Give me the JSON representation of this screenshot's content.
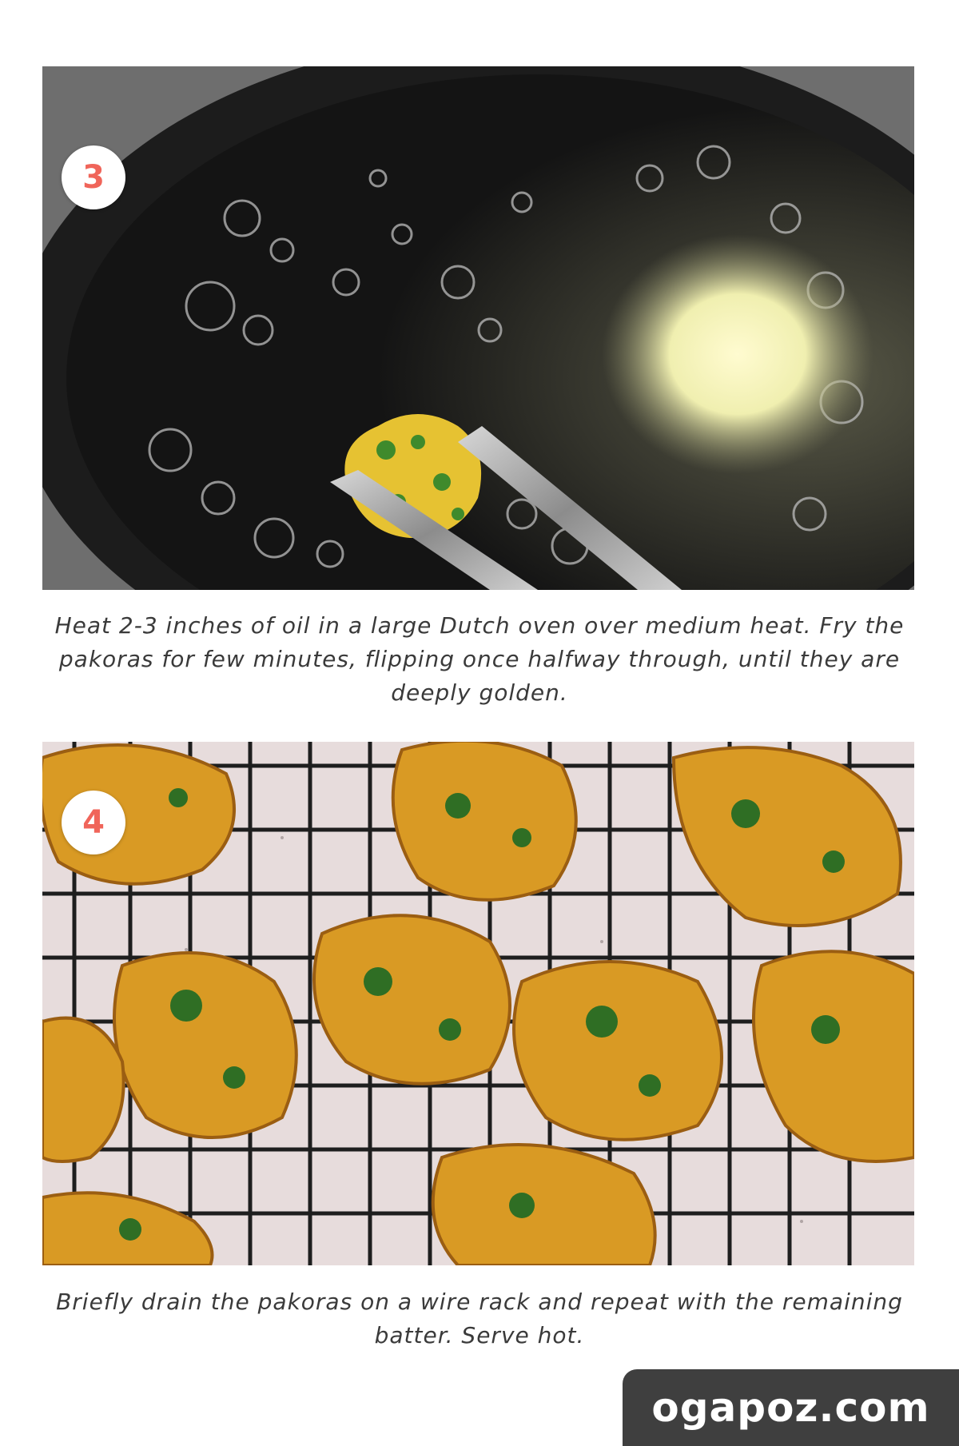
{
  "steps": [
    {
      "number": "3",
      "photo_subject": "pakora-frying-in-oil-with-tongs",
      "caption": "Heat 2-3 inches of oil in a large Dutch oven over medium heat. Fry the pakoras for few minutes, flipping once halfway through, until they are deeply golden."
    },
    {
      "number": "4",
      "photo_subject": "fried-pakoras-draining-on-wire-rack",
      "caption": "Briefly drain the pakoras on a wire rack and repeat with the remaining batter. Serve hot."
    }
  ],
  "watermark": "ogapoz.com",
  "colors": {
    "badge_number": "#f0655a",
    "badge_background": "#ffffff",
    "caption_text": "#3a3a3a",
    "watermark_background": "#3f3f3f",
    "watermark_text": "#ffffff"
  }
}
